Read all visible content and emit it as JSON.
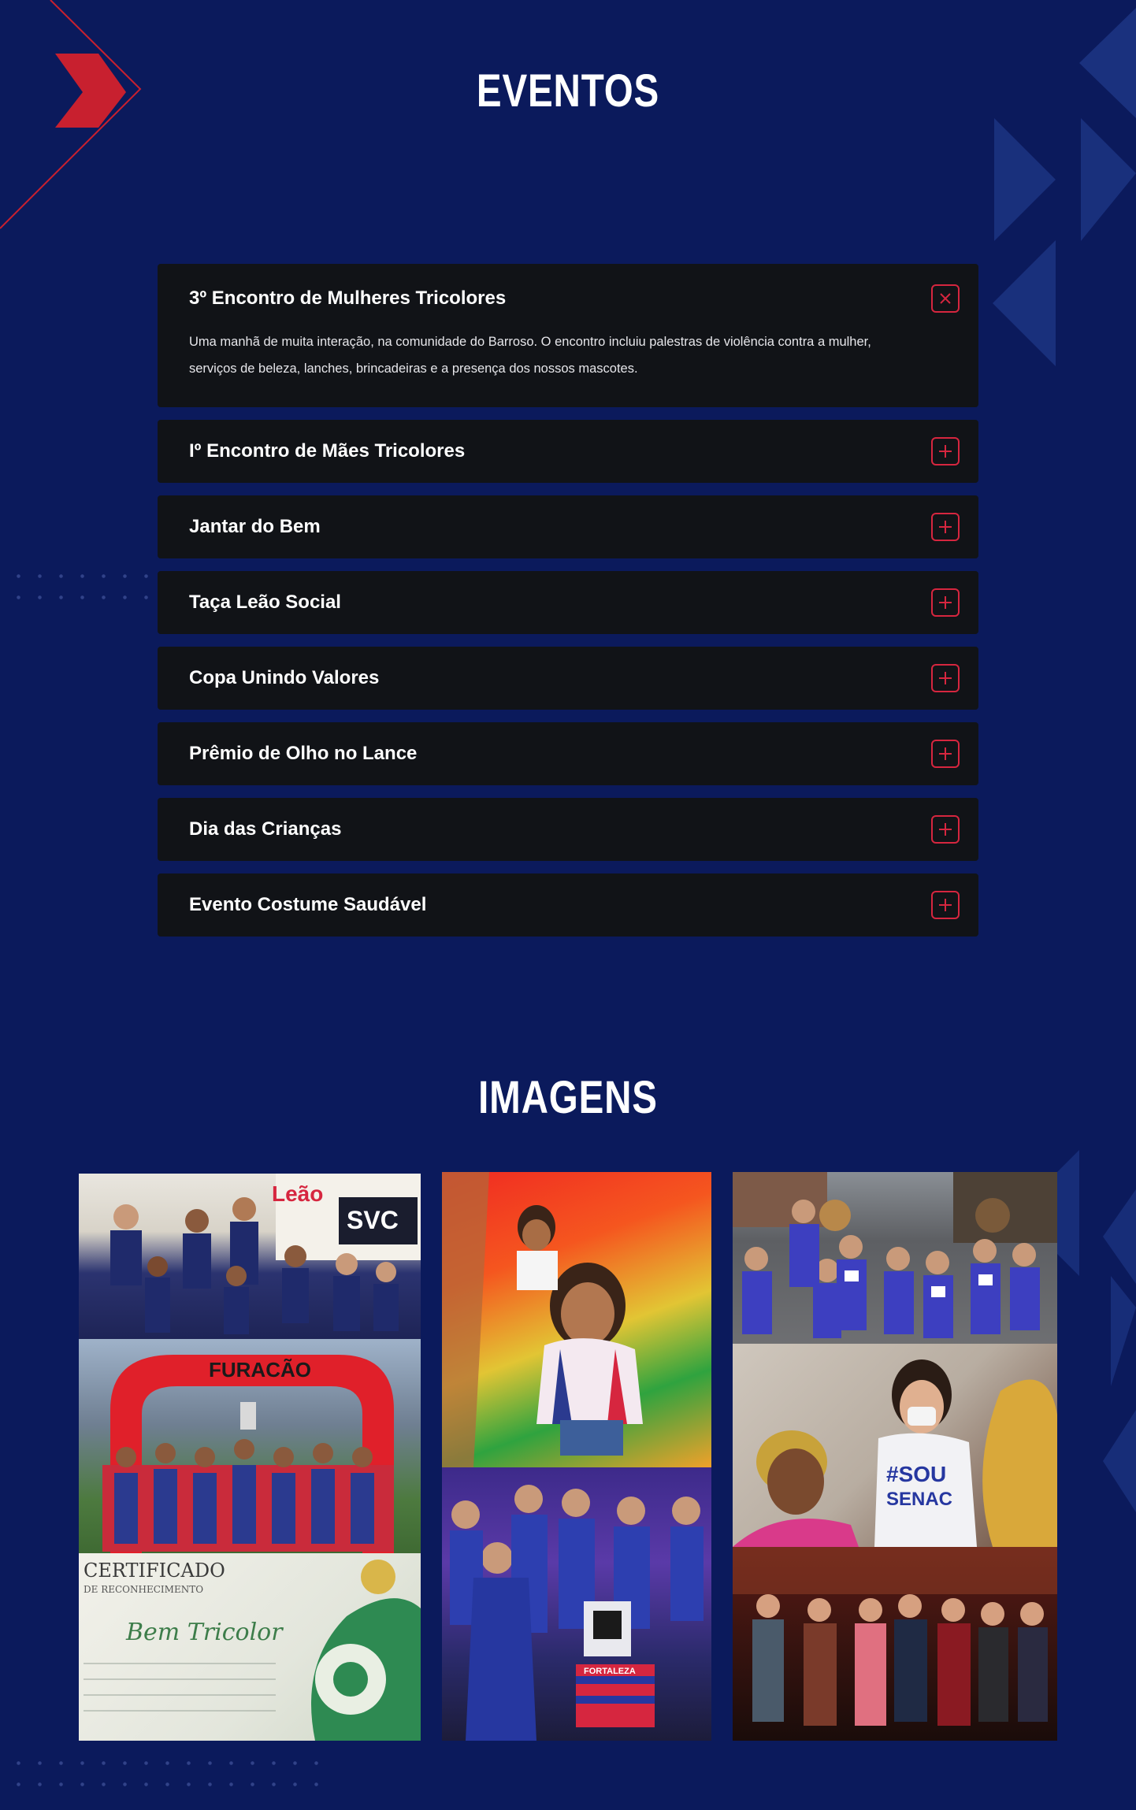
{
  "events": {
    "title": "EVENTOS",
    "items": [
      {
        "title": "3º Encontro de Mulheres Tricolores",
        "open": true,
        "description": "Uma manhã de muita interação, na comunidade do Barroso. O encontro incluiu palestras de violência contra a mulher, serviços de beleza, lanches, brincadeiras e a presença dos nossos mascotes."
      },
      {
        "title": "Iº Encontro de Mães Tricolores",
        "open": false
      },
      {
        "title": "Jantar do Bem",
        "open": false
      },
      {
        "title": "Taça Leão Social",
        "open": false
      },
      {
        "title": "Copa Unindo Valores",
        "open": false
      },
      {
        "title": "Prêmio de Olho no Lance",
        "open": false
      },
      {
        "title": "Dia das Crianças",
        "open": false
      },
      {
        "title": "Evento Costume Saudável",
        "open": false
      }
    ],
    "close_icon": "close-icon",
    "expand_icon": "plus-icon"
  },
  "images": {
    "title": "IMAGENS",
    "photos": [
      {
        "name": "photo-taca-leao-team",
        "text_in_image": "Taça Leão Social"
      },
      {
        "name": "photo-team-trophy-arch",
        "text_in_image": "FURACÃO"
      },
      {
        "name": "photo-certificate",
        "text_in_image": "CERTIFICADO DE RECONHECIMENTO"
      },
      {
        "name": "photo-girl-slide",
        "text_in_image": ""
      },
      {
        "name": "photo-group-booth",
        "text_in_image": "FORTALEZA"
      },
      {
        "name": "photo-community-group",
        "text_in_image": ""
      },
      {
        "name": "photo-beauty-service",
        "text_in_image": "#SOU SENAC"
      },
      {
        "name": "photo-dinner-group",
        "text_in_image": ""
      }
    ]
  },
  "colors": {
    "background": "#0b1a5c",
    "card": "#111317",
    "accent": "#d6263f"
  }
}
